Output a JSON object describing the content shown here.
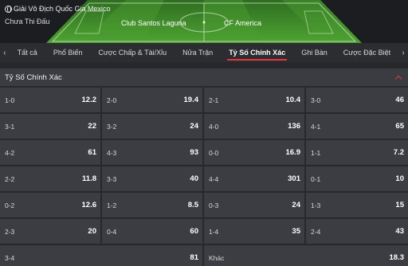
{
  "header": {
    "league": "Giải Vô Địch Quốc Gia Mexico",
    "status": "Chưa Thi Đấu",
    "home_team": "Club Santos Laguna",
    "away_team": "CF America"
  },
  "tabs": [
    "Tất cả",
    "Phổ Biến",
    "Cược Chấp & Tài/Xỉu",
    "Nửa Trận",
    "Tỷ Số Chính Xác",
    "Ghi Bàn",
    "Cược Đặc Biệt"
  ],
  "active_tab": "Tỷ Số Chính Xác",
  "market": {
    "title": "Tỷ Số Chính Xác",
    "rows": [
      [
        {
          "label": "1-0",
          "odd": "12.2"
        },
        {
          "label": "2-0",
          "odd": "19.4"
        },
        {
          "label": "2-1",
          "odd": "10.4"
        },
        {
          "label": "3-0",
          "odd": "46"
        }
      ],
      [
        {
          "label": "3-1",
          "odd": "22"
        },
        {
          "label": "3-2",
          "odd": "24"
        },
        {
          "label": "4-0",
          "odd": "136"
        },
        {
          "label": "4-1",
          "odd": "65"
        }
      ],
      [
        {
          "label": "4-2",
          "odd": "61"
        },
        {
          "label": "4-3",
          "odd": "93"
        },
        {
          "label": "0-0",
          "odd": "16.9"
        },
        {
          "label": "1-1",
          "odd": "7.2"
        }
      ],
      [
        {
          "label": "2-2",
          "odd": "11.8"
        },
        {
          "label": "3-3",
          "odd": "40"
        },
        {
          "label": "4-4",
          "odd": "301"
        },
        {
          "label": "0-1",
          "odd": "10"
        }
      ],
      [
        {
          "label": "0-2",
          "odd": "12.6"
        },
        {
          "label": "1-2",
          "odd": "8.5"
        },
        {
          "label": "0-3",
          "odd": "24"
        },
        {
          "label": "1-3",
          "odd": "15"
        }
      ],
      [
        {
          "label": "2-3",
          "odd": "20"
        },
        {
          "label": "0-4",
          "odd": "60"
        },
        {
          "label": "1-4",
          "odd": "35"
        },
        {
          "label": "2-4",
          "odd": "43"
        }
      ]
    ],
    "last_row": [
      {
        "label": "3-4",
        "odd": "81"
      },
      {
        "label": "Khác",
        "odd": "18.3"
      }
    ]
  },
  "colors": {
    "accent": "#e8343a",
    "pitch": "#3f8f2a",
    "cell": "#3b3d42"
  }
}
